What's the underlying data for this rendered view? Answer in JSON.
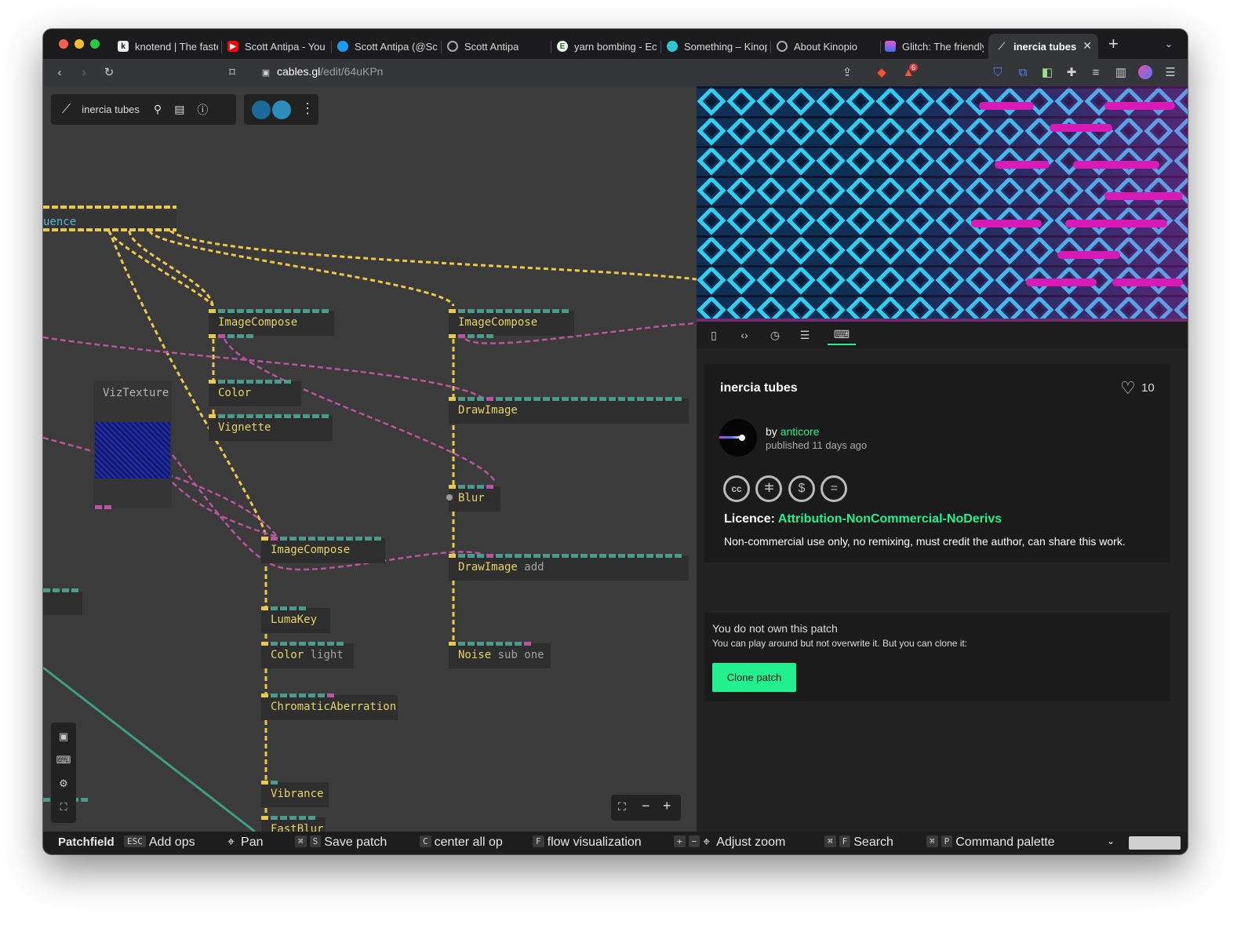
{
  "browser": {
    "tabs": [
      {
        "title": "knotend | The faste",
        "icon": "knotend-icon"
      },
      {
        "title": "Scott Antipa - You",
        "icon": "youtube-icon"
      },
      {
        "title": "Scott Antipa (@Sc",
        "icon": "twitter-icon"
      },
      {
        "title": "Scott Antipa",
        "icon": "globe-icon"
      },
      {
        "title": "yarn bombing - Ec",
        "icon": "ecosia-icon"
      },
      {
        "title": "Something – Kinop",
        "icon": "kinopio-icon"
      },
      {
        "title": "About Kinopio",
        "icon": "globe-icon"
      },
      {
        "title": "Glitch: The friendly",
        "icon": "glitch-icon"
      },
      {
        "title": "inercia tubes",
        "icon": "cables-icon",
        "active": true
      }
    ],
    "new_tab": "+",
    "address": {
      "host": "cables.gl",
      "path": "/edit/64uKPn"
    },
    "brave_badge": "6"
  },
  "patch": {
    "title": "inercia tubes",
    "ops": [
      {
        "name": "ImageCompose",
        "sub": ""
      },
      {
        "name": "ImageCompose",
        "sub": ""
      },
      {
        "name": "VizTexture",
        "sub": ""
      },
      {
        "name": "Color",
        "sub": ""
      },
      {
        "name": "Vignette",
        "sub": ""
      },
      {
        "name": "DrawImage",
        "sub": ""
      },
      {
        "name": "Blur",
        "sub": ""
      },
      {
        "name": "ImageCompose",
        "sub": ""
      },
      {
        "name": "DrawImage",
        "sub": "add"
      },
      {
        "name": "LumaKey",
        "sub": ""
      },
      {
        "name": "Color",
        "sub": "light"
      },
      {
        "name": "Noise",
        "sub": "sub one"
      },
      {
        "name": "ChromaticAberration",
        "sub": ""
      },
      {
        "name": "Vibrance",
        "sub": ""
      },
      {
        "name": "FastBlur",
        "sub": ""
      }
    ],
    "sequence_label": "uence",
    "zoom_controls": {
      "minus": "−",
      "plus": "+"
    }
  },
  "info": {
    "title": "inercia tubes",
    "likes": "10",
    "by_label": "by",
    "author": "anticore",
    "published": "published 11 days ago",
    "licence_label": "Licence:",
    "licence": "Attribution-NonCommercial-NoDerivs",
    "licence_desc": "Non-commercial use only, no remixing, must credit the author, can share this work.",
    "own_title": "You do not own this patch",
    "own_desc": "You can play around but not overwrite it. But you can clone it:",
    "clone_button": "Clone patch"
  },
  "statusbar": {
    "area": "Patchfield",
    "items": [
      {
        "keys": [
          "ESC"
        ],
        "label": "Add ops"
      },
      {
        "keys": [],
        "label": "Pan"
      },
      {
        "keys": [
          "⌘",
          "S"
        ],
        "label": "Save patch"
      },
      {
        "keys": [
          "C"
        ],
        "label": "center all op"
      },
      {
        "keys": [
          "F"
        ],
        "label": "flow visualization"
      },
      {
        "keys": [
          "+",
          "−"
        ],
        "label": "Adjust zoom"
      },
      {
        "keys": [
          "⌘",
          "F"
        ],
        "label": "Search"
      },
      {
        "keys": [
          "⌘",
          "P"
        ],
        "label": "Command palette"
      }
    ]
  },
  "colors": {
    "accent": "#22f08f",
    "op_text": "#e8d365",
    "link_yellow": "#e9c84a",
    "link_pink": "#b8559f",
    "link_teal": "#3e9d85"
  }
}
